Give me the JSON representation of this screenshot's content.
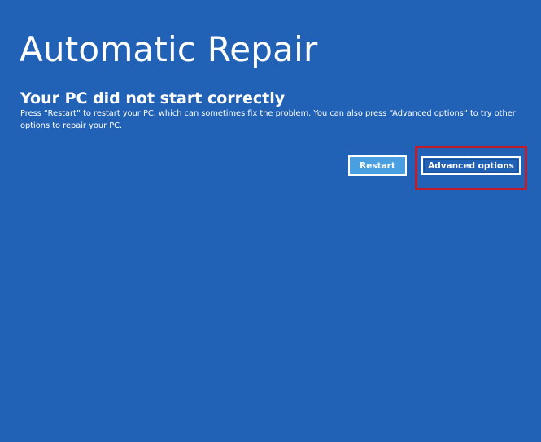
{
  "screen": {
    "title": "Automatic Repair",
    "subtitle": "Your PC did not start correctly",
    "description": "Press “Restart” to restart your PC, which can sometimes fix the problem. You can also press “Advanced options” to try other options to repair your PC."
  },
  "buttons": {
    "restart_label": "Restart",
    "advanced_label": "Advanced options"
  },
  "colors": {
    "background": "#2262b6",
    "restart_button": "#4a9fe1",
    "highlight": "#c21b2a"
  }
}
